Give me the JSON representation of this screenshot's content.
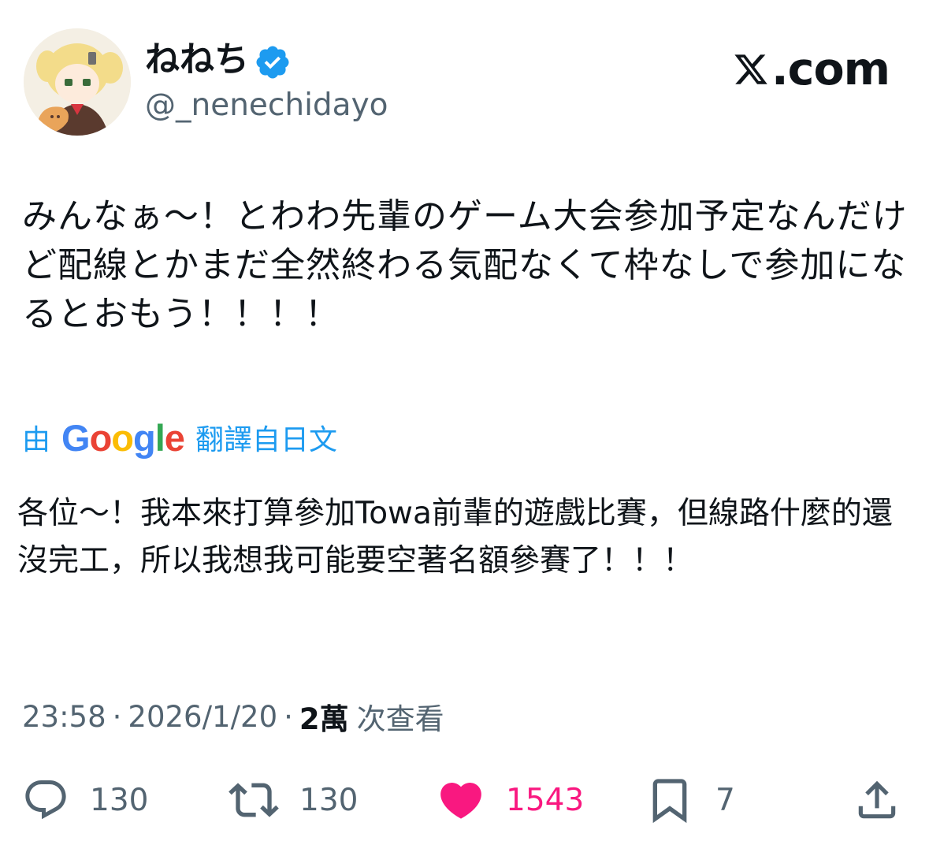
{
  "user": {
    "display_name": "ねねち",
    "handle": "@_nenechidayo",
    "verified_icon": "verified-badge-icon",
    "avatar_icon": "avatar"
  },
  "brand": {
    "text": ".com",
    "icon": "x-logo-icon"
  },
  "tweet": {
    "text": "みんなぁ〜！とわわ先輩のゲーム大会参加予定なんだけど配線とかまだ全然終わる気配なくて枠なしで参加になるとおもう！！！！"
  },
  "translation": {
    "prefix": "由",
    "provider": [
      "G",
      "o",
      "o",
      "g",
      "l",
      "e"
    ],
    "provider_colors": [
      "#4285F4",
      "#EA4335",
      "#FBBC05",
      "#4285F4",
      "#34A853",
      "#EA4335"
    ],
    "suffix": "翻譯自日文",
    "link_color": "#1d9bf0",
    "text": "各位〜！我本來打算參加Towa前輩的遊戲比賽，但線路什麼的還沒完工，所以我想我可能要空著名額參賽了！！！"
  },
  "meta": {
    "time": "23:58",
    "separator": "·",
    "date": "2026/1/20",
    "views_count": "2萬",
    "views_label": "次查看"
  },
  "actions": {
    "reply": {
      "icon": "reply-icon",
      "count": "130"
    },
    "retweet": {
      "icon": "retweet-icon",
      "count": "130"
    },
    "like": {
      "icon": "heart-icon",
      "count": "1543",
      "color": "#f91880"
    },
    "bookmark": {
      "icon": "bookmark-icon",
      "count": "7"
    },
    "share": {
      "icon": "share-icon"
    }
  }
}
